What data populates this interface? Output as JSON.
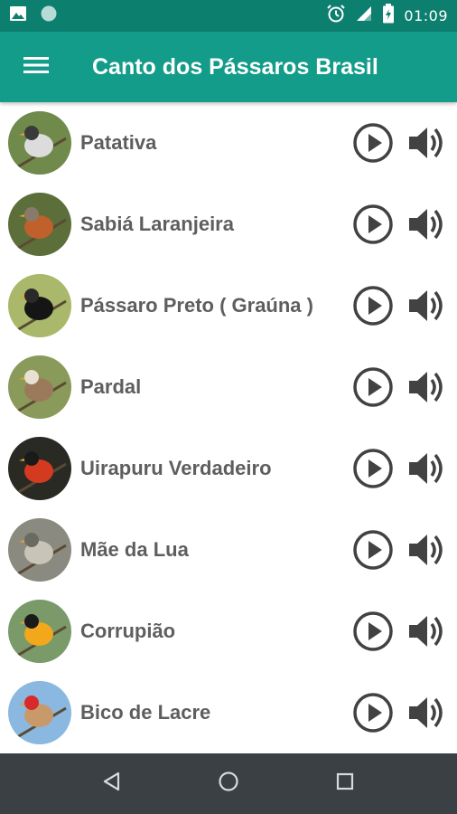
{
  "status_bar": {
    "time": "01:09",
    "left_icons": [
      "image-icon",
      "circle-notification-icon"
    ],
    "right_icons": [
      "alarm-icon",
      "signal-icon",
      "battery-icon"
    ]
  },
  "app_bar": {
    "title": "Canto dos Pássaros Brasil",
    "menu_icon": "hamburger-menu-icon",
    "color": "#139c8a",
    "status_color": "#0d7f6f"
  },
  "birds": [
    {
      "name": "Patativa",
      "bg": "#6f8a4a",
      "body": "#dcdcdc",
      "accent": "#3a3a3a"
    },
    {
      "name": "Sabiá Laranjeira",
      "bg": "#5c6f3a",
      "body": "#c0602a",
      "accent": "#8a7a6a"
    },
    {
      "name": "Pássaro Preto ( Graúna )",
      "bg": "#a9b86a",
      "body": "#151515",
      "accent": "#2a2a2a"
    },
    {
      "name": "Pardal",
      "bg": "#8a9a5a",
      "body": "#9a7a5a",
      "accent": "#e8e0d0"
    },
    {
      "name": "Uirapuru Verdadeiro",
      "bg": "#2a2a24",
      "body": "#d43a20",
      "accent": "#1a1a1a"
    },
    {
      "name": "Mãe da Lua",
      "bg": "#8a8a80",
      "body": "#c8c4b8",
      "accent": "#6a6a60"
    },
    {
      "name": "Corrupião",
      "bg": "#7a9a6a",
      "body": "#f2a81a",
      "accent": "#1a1a1a"
    },
    {
      "name": "Bico de Lacre",
      "bg": "#8ab8e0",
      "body": "#c89a6a",
      "accent": "#d82a2a"
    }
  ],
  "row_icons": {
    "play": "play-circle-icon",
    "volume": "volume-icon"
  },
  "nav_bar": {
    "back": "back-icon",
    "home": "home-icon",
    "recents": "recents-icon"
  }
}
